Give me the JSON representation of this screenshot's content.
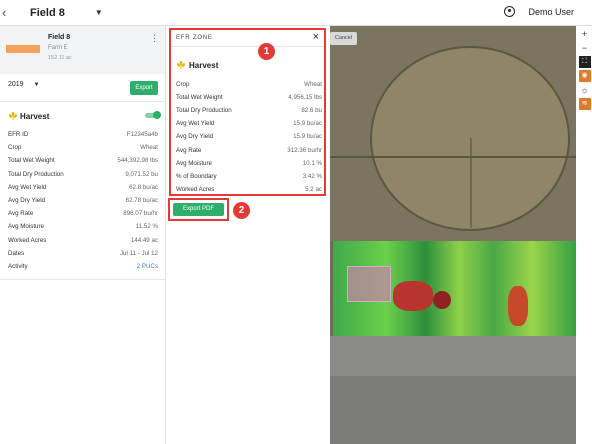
{
  "header": {
    "back_icon": "chevron-left-icon",
    "field_title": "Field 8",
    "user_name": "Demo User"
  },
  "field_card": {
    "name": "Field 8",
    "farm": "Farm E",
    "area": "152.11 ac"
  },
  "controls": {
    "year": "2019",
    "export_label": "Export"
  },
  "layer": {
    "name": "Harvest",
    "enabled": true
  },
  "field_stats": [
    {
      "label": "EFR ID",
      "value": "F12345a4b"
    },
    {
      "label": "Crop",
      "value": "Wheat"
    },
    {
      "label": "Total Wet Weight",
      "value": "544,392.98 lbs"
    },
    {
      "label": "Total Dry Production",
      "value": "9,071.52 bu"
    },
    {
      "label": "Avg Wet Yield",
      "value": "62.8 bu/ac"
    },
    {
      "label": "Avg Dry Yield",
      "value": "62.78 bu/ac"
    },
    {
      "label": "Avg Rate",
      "value": "896.07 bu/hr"
    },
    {
      "label": "Avg Moisture",
      "value": "11.52 %"
    },
    {
      "label": "Worked Acres",
      "value": "144.49 ac"
    },
    {
      "label": "Dates",
      "value": "Jul 11 - Jul 12"
    },
    {
      "label": "Activity",
      "value": "2 PUCs"
    }
  ],
  "efr_zone": {
    "title": "EFR ZONE",
    "layer_name": "Harvest",
    "stats": [
      {
        "label": "Crop",
        "value": "Wheat"
      },
      {
        "label": "Total Wet Weight",
        "value": "4,956.15 lbs"
      },
      {
        "label": "Total Dry Production",
        "value": "82.6 bu"
      },
      {
        "label": "Avg Wet Yield",
        "value": "15.9 bu/ac"
      },
      {
        "label": "Avg Dry Yield",
        "value": "15.9 bu/ac"
      },
      {
        "label": "Avg Rate",
        "value": "312.36 bu/hr"
      },
      {
        "label": "Avg Moisture",
        "value": "10.1 %"
      },
      {
        "label": "% of Boundary",
        "value": "3.42 %"
      },
      {
        "label": "Worked Acres",
        "value": "5.2 ac"
      }
    ],
    "export_pdf_label": "Export PDF"
  },
  "map": {
    "cancel_label": "Cancel",
    "tools": [
      "zoom-in-icon",
      "zoom-out-icon",
      "fullscreen-icon",
      "layers-icon",
      "weather-icon",
      "stack-icon"
    ]
  },
  "annotations": {
    "badge_1": "1",
    "badge_2": "2"
  },
  "colors": {
    "accent_green": "#2eae6b",
    "highlight_red": "#e53935",
    "harvest_gold": "#e7b400"
  }
}
